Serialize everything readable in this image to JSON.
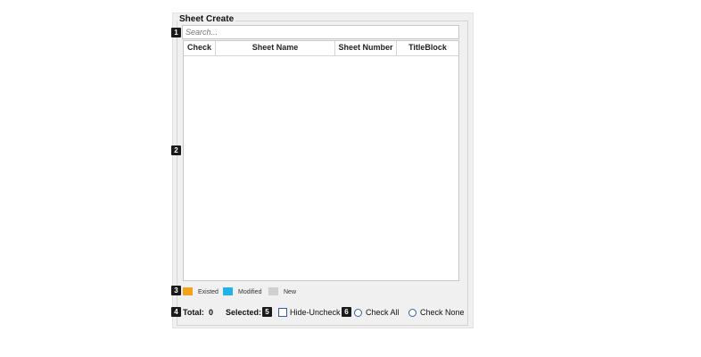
{
  "group": {
    "title": "Sheet Create"
  },
  "search": {
    "placeholder": "Search..."
  },
  "table": {
    "columns": [
      "Check",
      "Sheet Name",
      "Sheet Number",
      "TitleBlock"
    ],
    "rows": []
  },
  "legend": [
    {
      "label": "Existed",
      "color": "#f5a21b"
    },
    {
      "label": "Modified",
      "color": "#1fb3e8"
    },
    {
      "label": "New",
      "color": "#cfcfcf"
    }
  ],
  "footer": {
    "total_label": "Total:",
    "total_value": "0",
    "selected_label": "Selected:",
    "hide_uncheck_label": "Hide-Uncheck",
    "check_all_label": "Check All",
    "check_none_label": "Check None"
  },
  "badges": [
    "1",
    "2",
    "3",
    "4",
    "5",
    "6"
  ]
}
